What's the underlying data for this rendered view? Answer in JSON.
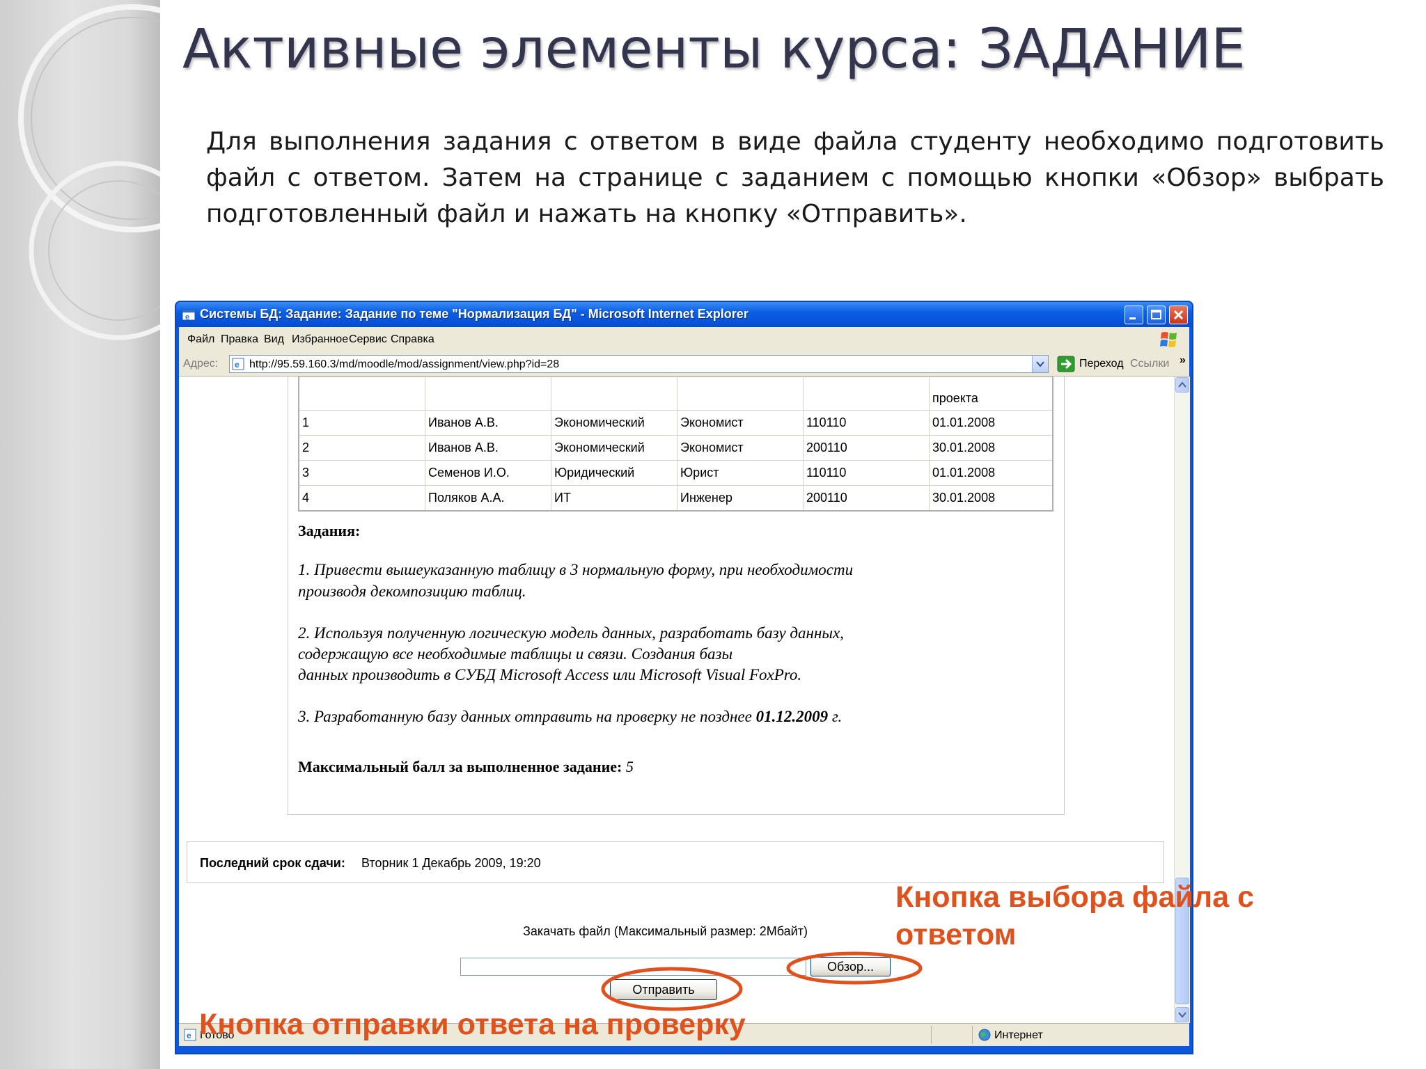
{
  "slide": {
    "title": "Активные элементы курса: ЗАДАНИЕ",
    "body": "Для выполнения задания с ответом в виде файла студенту необходимо подготовить файл с ответом. Затем на странице с заданием с помощью кнопки «Обзор» выбрать подготовленный файл и нажать на кнопку «Отправить»."
  },
  "window": {
    "title": "Системы БД: Задание: Задание по теме \"Нормализация БД\" - Microsoft Internet Explorer",
    "menu": [
      "Файл",
      "Правка",
      "Вид",
      "Избранное",
      "Сервис",
      "Справка"
    ],
    "address_label": "Адрес:",
    "url": "http://95.59.160.3/md/moodle/mod/assignment/view.php?id=28",
    "go_label": "Переход",
    "links_label": "Ссылки",
    "links_chevron": "»",
    "status_text": "Готово",
    "zone_text": "Интернет"
  },
  "table": {
    "header_last": "проекта",
    "rows": [
      [
        "1",
        "Иванов А.В.",
        "Экономический",
        "Экономист",
        "110110",
        "01.01.2008"
      ],
      [
        "2",
        "Иванов А.В.",
        "Экономический",
        "Экономист",
        "200110",
        "30.01.2008"
      ],
      [
        "3",
        "Семенов И.О.",
        "Юридический",
        "Юрист",
        "110110",
        "01.01.2008"
      ],
      [
        "4",
        "Поляков А.А.",
        "ИТ",
        "Инженер",
        "200110",
        "30.01.2008"
      ]
    ]
  },
  "tasks": {
    "heading": "Задания:",
    "t1_line1": "1. Привести вышеуказанную таблицу в 3 нормальную форму, при необходимости",
    "t1_line2": "производя декомпозицию таблиц.",
    "t2_line1": "2. Используя полученную логическую модель данных, разработать базу данных,",
    "t2_line2": "содержащую все необходимые таблицы и связи. Создания базы",
    "t2_line3": "данных производить в СУБД  Microsoft Access или Microsoft Visual FoxPro.",
    "t3_prefix": "3. Разработанную базу данных отправить на проверку не позднее ",
    "t3_date": "01.12.2009",
    "t3_suffix": " г.",
    "max_label": "Максимальный балл за выполненное задание:",
    "max_value": " 5"
  },
  "deadline": {
    "label": "Последний срок сдачи:",
    "value": "Вторник 1 Декабрь 2009, 19:20"
  },
  "upload": {
    "label": "Закачать файл (Максимальный размер: 2Мбайт)",
    "file_value": "",
    "browse_label": "Обзор...",
    "submit_label": "Отправить"
  },
  "annotations": {
    "browse": "Кнопка выбора файла с ответом",
    "submit": "Кнопка отправки ответа на проверку",
    "color": "#e0521d"
  }
}
